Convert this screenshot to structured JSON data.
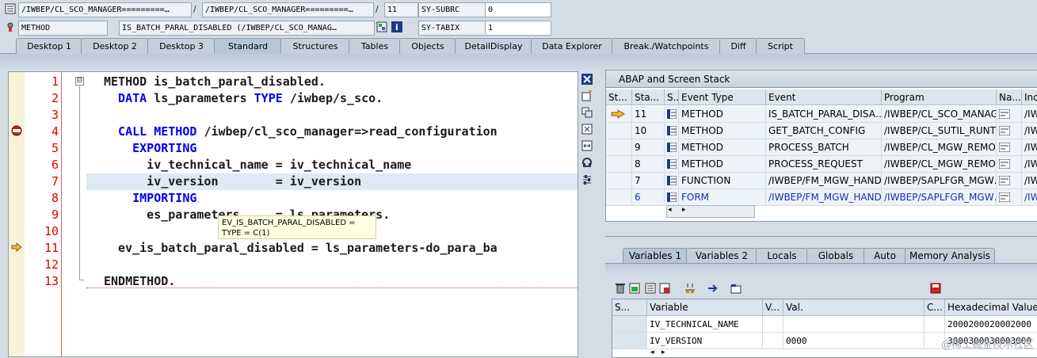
{
  "header": {
    "row1": {
      "field1": "/IWBEP/CL_SCO_MANAGER=========…",
      "sep1": "/",
      "field2": "/IWBEP/CL_SCO_MANAGER=========…",
      "sep2": "/",
      "field3": "11",
      "label": "SY-SUBRC",
      "value": "0"
    },
    "row2": {
      "field1": "METHOD",
      "field2": "IS_BATCH_PARAL_DISABLED (/IWBEP/CL_SCO_MANAG…",
      "label": "SY-TABIX",
      "value": "1"
    }
  },
  "tabs": [
    "Desktop 1",
    "Desktop 2",
    "Desktop 3",
    "Standard",
    "Structures",
    "Tables",
    "Objects",
    "DetailDisplay",
    "Data Explorer",
    "Break./Watchpoints",
    "Diff",
    "Script"
  ],
  "editor": {
    "line_numbers": [
      "1",
      "2",
      "3",
      "4",
      "5",
      "6",
      "7",
      "8",
      "9",
      "10",
      "11",
      "12",
      "13"
    ],
    "fold_symbol": "⊟",
    "lines": {
      "l1": "METHOD is_batch_paral_disabled.",
      "l2a": "  DATA ",
      "l2b": "ls_parameters ",
      "l2c": "TYPE ",
      "l2d": "/iwbep/s_sco.",
      "l4a": "  CALL METHOD ",
      "l4b": "/iwbep/cl_sco_manager=>read_configuration",
      "l5": "    EXPORTING",
      "l6": "      iv_technical_name = iv_technical_name",
      "l7": "      iv_version        = iv_version",
      "l8": "    IMPORTING",
      "l9": "      es_parameters     = ls_parameters.",
      "l11": "  ev_is_batch_paral_disabled = ls_parameters-do_para_ba",
      "l13": "ENDMETHOD."
    },
    "tooltip_line1": "EV_IS_BATCH_PARAL_DISABLED =",
    "tooltip_line2": "TYPE  = C(1)"
  },
  "stack": {
    "title": "ABAP and Screen Stack",
    "headers": [
      "St...",
      "Sta...",
      "S...",
      "Event Type",
      "Event",
      "Program",
      "Na...",
      "Inc"
    ],
    "rows": [
      {
        "sta": "11",
        "type": "METHOD",
        "event": "IS_BATCH_PARAL_DISA…",
        "program": "/IWBEP/CL_SCO_MANAG…",
        "inc": "/IW"
      },
      {
        "sta": "10",
        "type": "METHOD",
        "event": "GET_BATCH_CONFIG",
        "program": "/IWBEP/CL_SUTIL_RUNT…",
        "inc": "/IW"
      },
      {
        "sta": "9",
        "type": "METHOD",
        "event": "PROCESS_BATCH",
        "program": "/IWBEP/CL_MGW_REMO…",
        "inc": "/IW"
      },
      {
        "sta": "8",
        "type": "METHOD",
        "event": "PROCESS_REQUEST",
        "program": "/IWBEP/CL_MGW_REMO…",
        "inc": "/IW"
      },
      {
        "sta": "7",
        "type": "FUNCTION",
        "event": "/IWBEP/FM_MGW_HAND…",
        "program": "/IWBEP/SAPLFGR_MGW…",
        "inc": "/IW"
      },
      {
        "sta": "6",
        "type": "FORM",
        "event": "/IWBEP/FM_MGW_HAND…",
        "program": "/IWBEP/SAPLFGR_MGW…",
        "inc": "/IW"
      }
    ]
  },
  "vars": {
    "tabs": [
      "Variables 1",
      "Variables 2",
      "Locals",
      "Globals",
      "Auto",
      "Memory Analysis"
    ],
    "headers": [
      "S...",
      "Variable",
      "V...",
      "Val.",
      "C...",
      "Hexadecimal Value"
    ],
    "rows": [
      {
        "variable": "IV_TECHNICAL_NAME",
        "val": "",
        "hex": "2000200020002000"
      },
      {
        "variable": "IV_VERSION",
        "val": "0000",
        "hex": "3000300030003000"
      }
    ]
  },
  "watermark": "@稀土掘金技术社区",
  "colors": {
    "keyword": "#0000ee",
    "line_number": "#e00000",
    "highlight": "#dfe8f5"
  }
}
